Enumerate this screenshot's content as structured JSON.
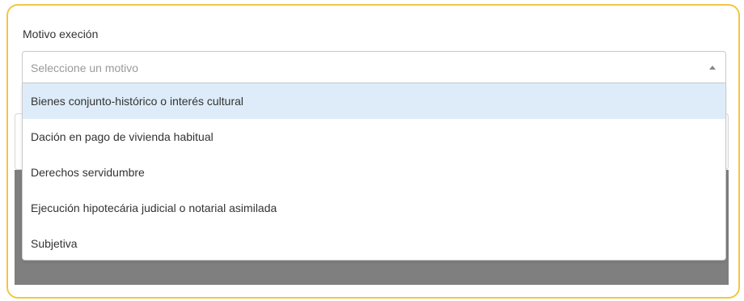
{
  "form": {
    "label": "Motivo execión",
    "select": {
      "placeholder": "Seleccione un motivo",
      "options": [
        {
          "label": "Bienes conjunto-histórico o interés cultural"
        },
        {
          "label": "Dación en pago de vivienda habitual"
        },
        {
          "label": "Derechos servidumbre"
        },
        {
          "label": "Ejecución hipotecária judicial o notarial asimilada"
        },
        {
          "label": "Subjetiva"
        }
      ],
      "highlighted_index": 0
    }
  },
  "colors": {
    "card_border": "#f5c542",
    "highlight": "#ddecf8",
    "backdrop_grey": "#7f7f7f"
  },
  "icons": {
    "caret": "caret-up-icon"
  }
}
